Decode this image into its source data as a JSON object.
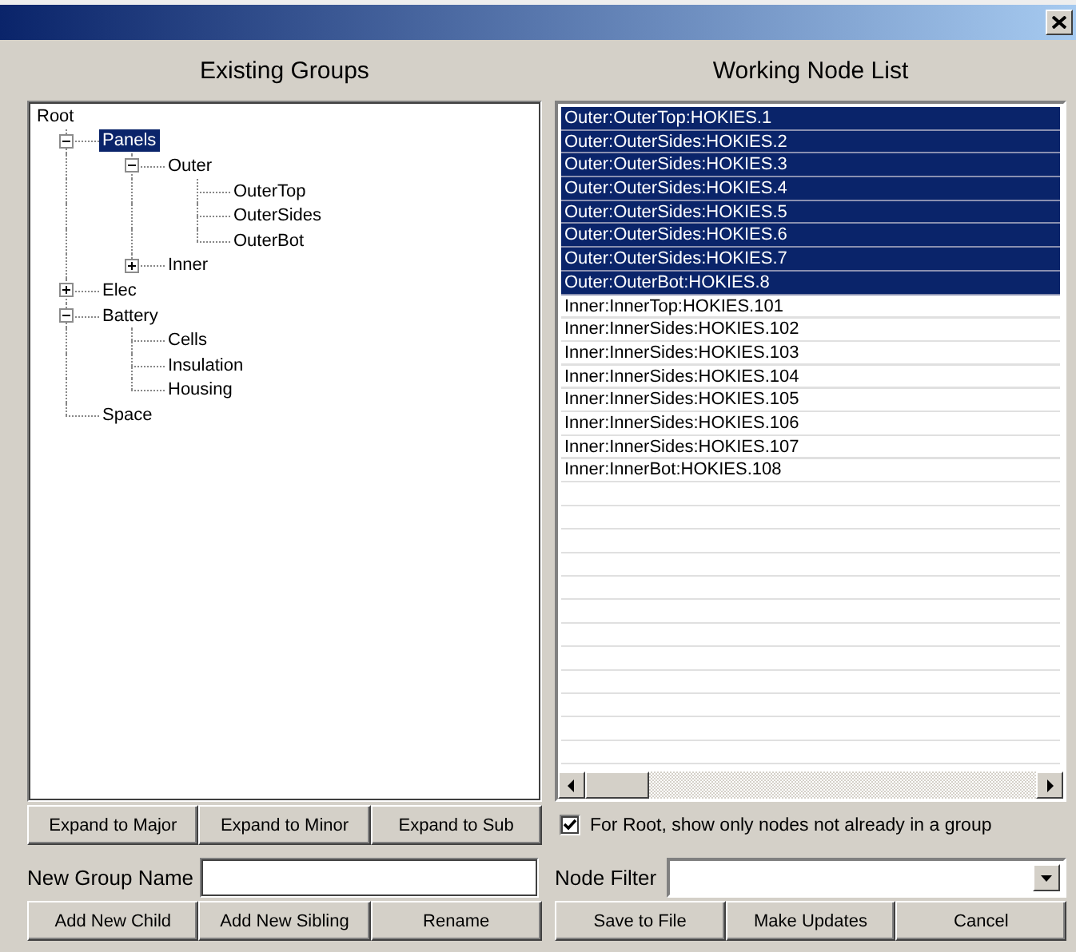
{
  "groups": {
    "heading": "Existing Groups",
    "tree": [
      {
        "label": "Root",
        "selected": false,
        "children": [
          {
            "label": "Panels",
            "selected": true,
            "expanded": true,
            "children": [
              {
                "label": "Outer",
                "selected": false,
                "expanded": true,
                "children": [
                  {
                    "label": "OuterTop",
                    "selected": false
                  },
                  {
                    "label": "OuterSides",
                    "selected": false
                  },
                  {
                    "label": "OuterBot",
                    "selected": false
                  }
                ]
              },
              {
                "label": "Inner",
                "selected": false,
                "expanded": false
              }
            ]
          },
          {
            "label": "Elec",
            "selected": false,
            "expanded": false
          },
          {
            "label": "Battery",
            "selected": false,
            "expanded": true,
            "children": [
              {
                "label": "Cells",
                "selected": false
              },
              {
                "label": "Insulation",
                "selected": false
              },
              {
                "label": "Housing",
                "selected": false
              }
            ]
          },
          {
            "label": "Space",
            "selected": false
          }
        ]
      }
    ]
  },
  "node_list": {
    "heading": "Working Node List",
    "items": [
      {
        "label": "Outer:OuterTop:HOKIES.1",
        "selected": true
      },
      {
        "label": "Outer:OuterSides:HOKIES.2",
        "selected": true
      },
      {
        "label": "Outer:OuterSides:HOKIES.3",
        "selected": true
      },
      {
        "label": "Outer:OuterSides:HOKIES.4",
        "selected": true
      },
      {
        "label": "Outer:OuterSides:HOKIES.5",
        "selected": true
      },
      {
        "label": "Outer:OuterSides:HOKIES.6",
        "selected": true
      },
      {
        "label": "Outer:OuterSides:HOKIES.7",
        "selected": true
      },
      {
        "label": "Outer:OuterBot:HOKIES.8",
        "selected": true
      },
      {
        "label": "Inner:InnerTop:HOKIES.101",
        "selected": false
      },
      {
        "label": "Inner:InnerSides:HOKIES.102",
        "selected": false
      },
      {
        "label": "Inner:InnerSides:HOKIES.103",
        "selected": false
      },
      {
        "label": "Inner:InnerSides:HOKIES.104",
        "selected": false
      },
      {
        "label": "Inner:InnerSides:HOKIES.105",
        "selected": false
      },
      {
        "label": "Inner:InnerSides:HOKIES.106",
        "selected": false
      },
      {
        "label": "Inner:InnerSides:HOKIES.107",
        "selected": false
      },
      {
        "label": "Inner:InnerBot:HOKIES.108",
        "selected": false
      }
    ]
  },
  "expand_buttons": [
    "Expand to Major",
    "Expand to Minor",
    "Expand to Sub"
  ],
  "root_filter": {
    "label": "For Root, show only nodes not already in a group",
    "checked": true
  },
  "new_group_name": {
    "label": "New Group Name"
  },
  "node_filter": {
    "label": "Node Filter"
  },
  "group_buttons": [
    "Add New Child",
    "Add New Sibling",
    "Rename"
  ],
  "list_buttons": [
    "Save to File",
    "Make Updates",
    "Cancel"
  ]
}
